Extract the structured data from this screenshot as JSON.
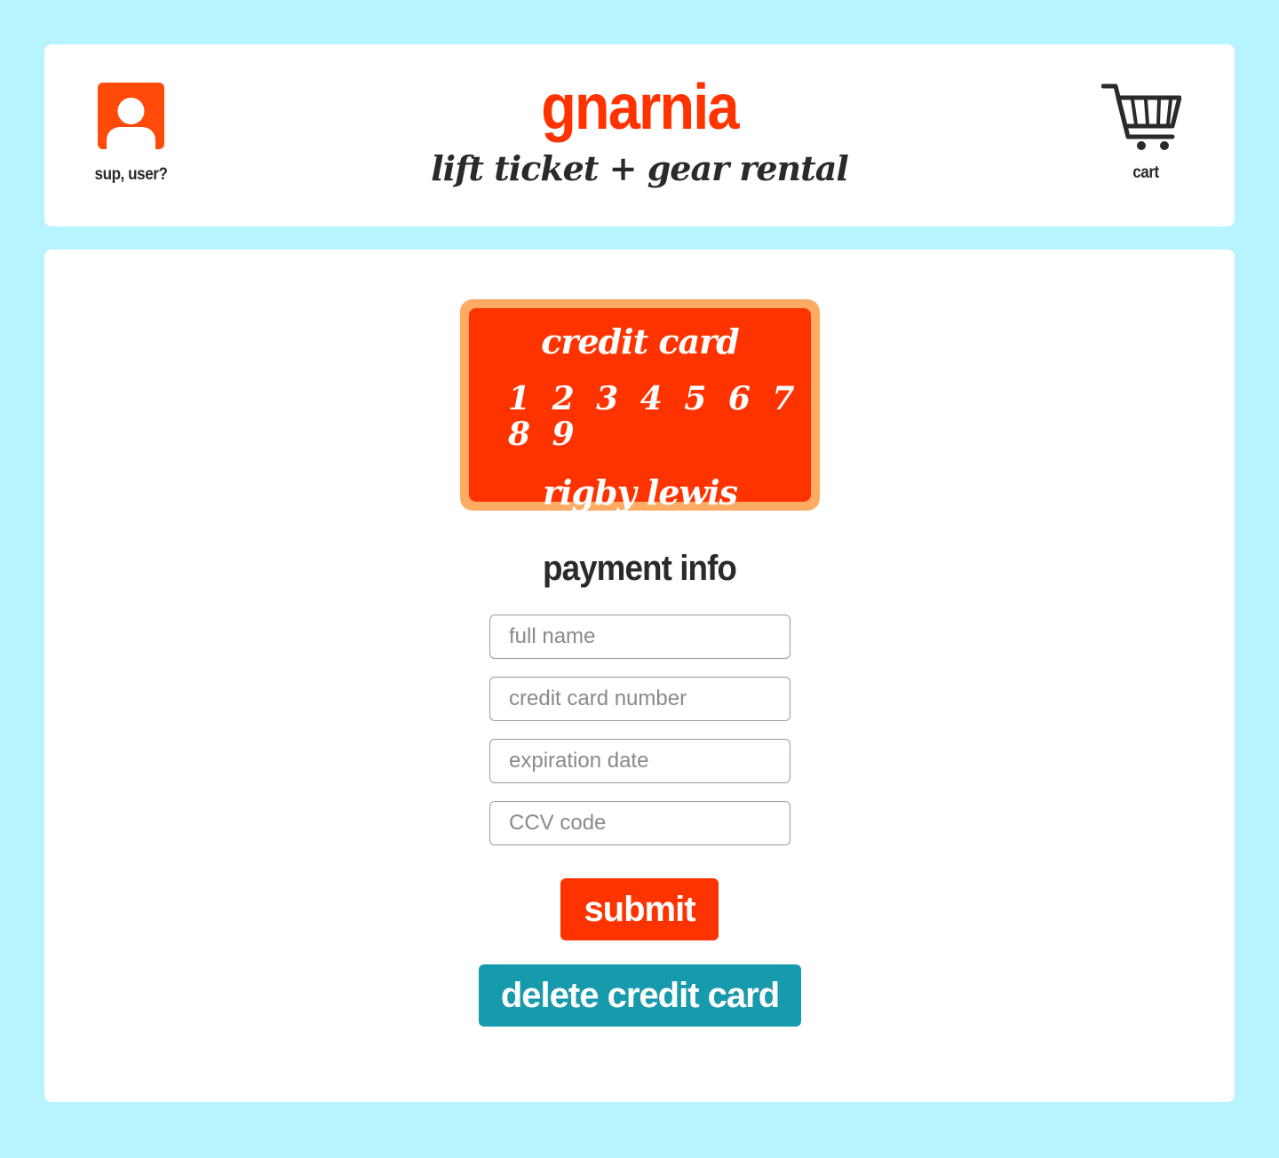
{
  "header": {
    "user_label": "sup, user?",
    "brand_title": "gnarnia",
    "brand_subtitle": "lift ticket + gear rental",
    "cart_label": "cart"
  },
  "icons": {
    "user": "user-avatar-icon",
    "cart": "shopping-cart-icon"
  },
  "card": {
    "title": "credit card",
    "number": "1 2 3 4 5 6 7 8 9",
    "holder": "rigby lewis"
  },
  "payment": {
    "title": "payment info",
    "fields": {
      "full_name": {
        "placeholder": "full name",
        "value": ""
      },
      "card_number": {
        "placeholder": "credit card number",
        "value": ""
      },
      "expiration": {
        "placeholder": "expiration date",
        "value": ""
      },
      "ccv": {
        "placeholder": "CCV code",
        "value": ""
      }
    },
    "submit_label": "submit",
    "delete_label": "delete credit card"
  },
  "colors": {
    "background": "#b8f4fd",
    "panel": "#ffffff",
    "accent": "#ff3300",
    "card_border": "#ffab63",
    "avatar": "#ff4a0a",
    "delete_button": "#179aab",
    "text_dark": "#2a2a2a"
  }
}
